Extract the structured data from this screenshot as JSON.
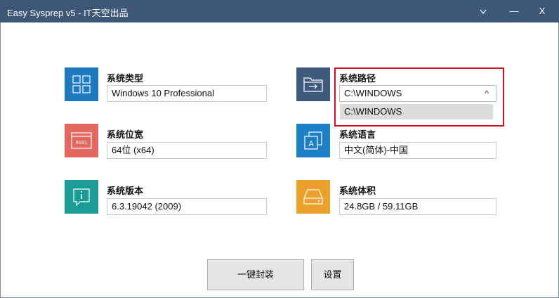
{
  "window": {
    "title": "Easy Sysprep v5 - IT天空出品",
    "minimize_glyph": "—",
    "close_glyph": "X"
  },
  "fields": {
    "system_type": {
      "label": "系统类型",
      "value": "Windows 10 Professional",
      "icon": "windows-grid-icon",
      "color": "#1e79bf"
    },
    "system_bits": {
      "label": "系统位宽",
      "value": "64位 (x64)",
      "icon": "binary-window-icon",
      "color": "#e2675f"
    },
    "system_version": {
      "label": "系统版本",
      "value": "6.3.19042 (2009)",
      "icon": "info-icon",
      "color": "#1a9b96"
    },
    "system_path": {
      "label": "系统路径",
      "value": "C:\\WINDOWS",
      "icon": "folder-arrow-icon",
      "color": "#3f5a7d",
      "dropdown_option": "C:\\WINDOWS",
      "arrow": "^"
    },
    "system_language": {
      "label": "系统语言",
      "value": "中文(简体)-中国",
      "icon": "language-icon",
      "color": "#1d7fc4"
    },
    "system_volume": {
      "label": "系统体积",
      "value": "24.8GB / 59.11GB",
      "icon": "hard-drive-icon",
      "color": "#eba02c"
    }
  },
  "buttons": {
    "one_click": "一键封装",
    "settings": "设置"
  },
  "colors": {
    "titlebar": "#3d5877",
    "highlight_box": "#d0111b"
  }
}
